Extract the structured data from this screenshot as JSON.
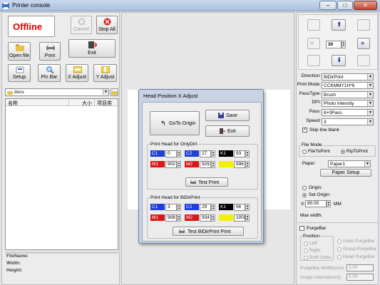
{
  "window": {
    "title": "Printer console",
    "min": "–",
    "max": "□",
    "close": "✕"
  },
  "left": {
    "status": "Offline",
    "cancel": "Cancel",
    "stop_all": "Stop All",
    "open_file": "Open file",
    "print": "Print",
    "exit": "Exit",
    "setup": "Setup",
    "pin_bar": "Pin Bar",
    "x_adjust": "X Adjust",
    "y_adjust": "Y Adjust",
    "folder": "docs",
    "col_name": "名称",
    "col_size": "大小",
    "col_items": "项目类",
    "file_name": "FileName:",
    "width": "Width:",
    "height": "Height:"
  },
  "dialog": {
    "title": "Head Position X Adjust",
    "goto_origin": "GoTo Origin",
    "save": "Save",
    "exit": "Exit",
    "group1": "Print Head for OnlyDirt",
    "group2": "Print Head for BiDirPrint",
    "test_print": "Test Print",
    "test_bidir": "Test BiDirPrint Print",
    "g1": [
      [
        {
          "tag": "C1",
          "val": "0",
          "color": "#1f3fd6"
        },
        {
          "tag": "C2",
          "val": "27",
          "color": "#1f3fd6"
        },
        {
          "tag": "K1",
          "val": "93",
          "color": "#000000"
        }
      ],
      [
        {
          "tag": "M1",
          "val": "902",
          "color": "#d81818"
        },
        {
          "tag": "M2",
          "val": "929",
          "color": "#d81818"
        },
        {
          "tag": "",
          "val": "996",
          "color": "#f2f200"
        }
      ]
    ],
    "g2": [
      [
        {
          "tag": "C1",
          "val": "3",
          "color": "#1f3fd6"
        },
        {
          "tag": "C2",
          "val": "29",
          "color": "#1f3fd6"
        },
        {
          "tag": "K1",
          "val": "96",
          "color": "#000000"
        }
      ],
      [
        {
          "tag": "M1",
          "val": "908",
          "color": "#d81818"
        },
        {
          "tag": "M2",
          "val": "934",
          "color": "#d81818"
        },
        {
          "tag": "",
          "val": "1001",
          "color": "#f2f200"
        }
      ]
    ]
  },
  "right": {
    "move_step": "30",
    "direction_label": "Direction:",
    "direction": "BiDirPrint",
    "printmode_label": "Print Mode:",
    "printmode": "CCKMMY1H*6",
    "passtype_label": "PassType:",
    "passtype": "Brush",
    "dpi_label": "DPI:",
    "dpi": "Photo intensity",
    "pass_label": "Pass:",
    "pass": "8+0Pass",
    "speed_label": "Speed:",
    "speed": "3",
    "skip_line": "Skip line blank",
    "file_mode": "File Mode",
    "file_to_print": "FileToPrint",
    "rip_to_print": "RipToPrint",
    "paper_label": "Paper:",
    "paper": "Paper1",
    "paper_setup": "Paper Setup",
    "origin": "Origin:",
    "set_origin": "Set Origin:",
    "x_label": "X:",
    "x_value": "80.00",
    "x_unit": "MM",
    "max_width": "Max width:",
    "purge_bar": "PurgeBar",
    "position": "Position",
    "left_opt": "Left",
    "right_opt": "Right",
    "both_sides": "Both Sides",
    "unite_purge": "Unite PurgeBar",
    "group_purge": "Group PurgeBar",
    "head_purge": "Head PurgeBar",
    "purge_width_label": "PurgeBar Width(mm):",
    "purge_width": "3.00",
    "image_interval_label": "Image Interval(mm):",
    "image_interval": "5.00"
  }
}
